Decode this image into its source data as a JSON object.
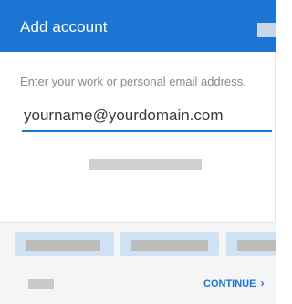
{
  "header": {
    "title": "Add account"
  },
  "form": {
    "instruction": "Enter your work or personal email address.",
    "email_value": "yourname@yourdomain.com"
  },
  "footer": {
    "continue_label": "CONTINUE",
    "continue_icon": "chevron-right-icon"
  },
  "colors": {
    "accent": "#1a76d2",
    "chip_background": "#cfe2f3"
  }
}
